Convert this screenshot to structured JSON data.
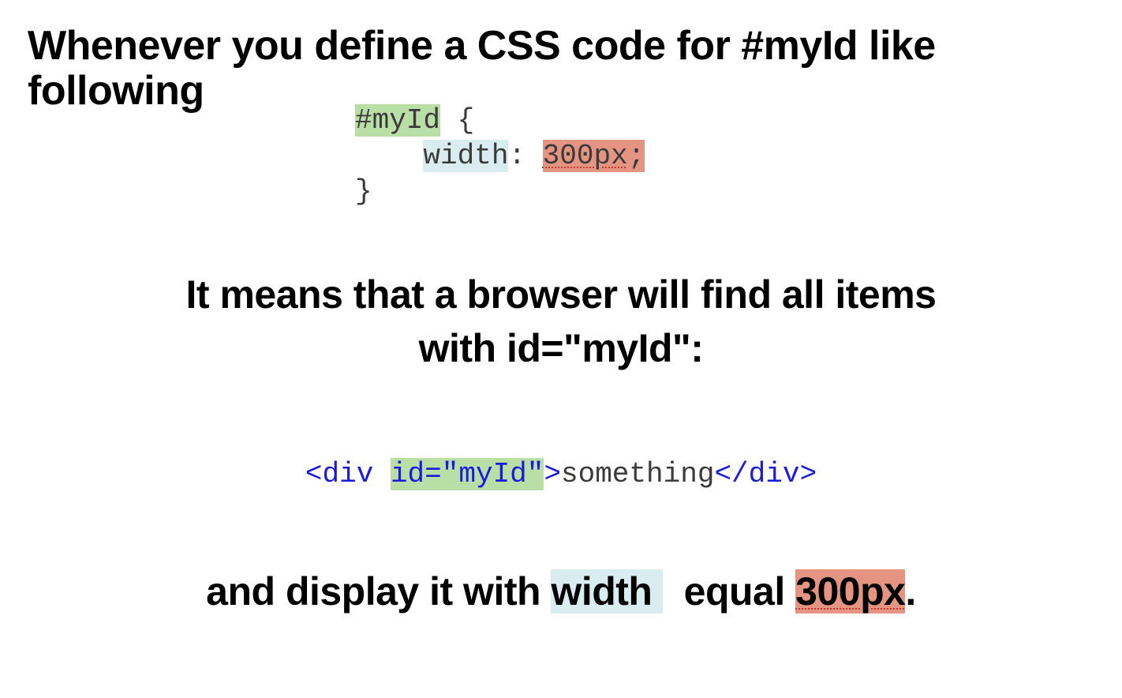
{
  "heading1": "Whenever you define a CSS code for #myId like following",
  "code1": {
    "selector": "#myId",
    "open": " {",
    "indent": "    ",
    "prop": "width",
    "colon": ": ",
    "value": "300px",
    "semi": ";",
    "close": "}"
  },
  "heading2_line1": "It means that a browser will find all items",
  "heading2_line2": "with id=\"myId\":",
  "code2": {
    "lt1": "<",
    "tag_open": "div",
    "space": " ",
    "attr": "id=\"myId\"",
    "gt1": ">",
    "content": "something",
    "lt2": "</",
    "tag_close": "div",
    "gt2": ">"
  },
  "heading3": {
    "pre": "and display it with ",
    "hl_width": " width ",
    "mid": "equal ",
    "hl_300": "300px",
    "dot": "."
  }
}
